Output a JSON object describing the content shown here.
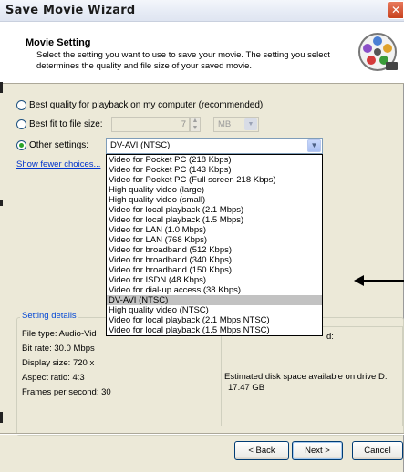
{
  "window": {
    "title": "Save Movie Wizard",
    "close_glyph": "✕"
  },
  "header": {
    "title": "Movie Setting",
    "description": "Select the setting you want to use to save your movie. The setting you select determines the quality and file size of your saved movie.",
    "icon": "film-reel-icon"
  },
  "options": {
    "best_quality_label": "Best quality for playback on my computer (recommended)",
    "best_fit_label": "Best fit to file size:",
    "file_size_value": "7",
    "unit_value": "MB",
    "other_settings_label": "Other settings:",
    "other_settings_value": "DV-AVI (NTSC)",
    "selected": "other_settings"
  },
  "show_fewer_link": "Show fewer choices...",
  "dropdown_options": [
    "Video for Pocket PC (218 Kbps)",
    "Video for Pocket PC (143 Kbps)",
    "Video for Pocket PC (Full screen 218 Kbps)",
    "High quality video (large)",
    "High quality video (small)",
    "Video for local playback (2.1 Mbps)",
    "Video for local playback (1.5 Mbps)",
    "Video for LAN (1.0 Mbps)",
    "Video for LAN (768 Kbps)",
    "Video for broadband (512 Kbps)",
    "Video for broadband (340 Kbps)",
    "Video for broadband (150 Kbps)",
    "Video for ISDN (48 Kbps)",
    "Video for dial-up access (38 Kbps)",
    "DV-AVI (NTSC)",
    "High quality video (NTSC)",
    "Video for local playback (2.1 Mbps NTSC)",
    "Video for local playback (1.5 Mbps NTSC)"
  ],
  "dropdown_selected_index": 14,
  "details": {
    "legend": "Setting details",
    "file_type": "File type: Audio-Vid",
    "bit_rate": "Bit rate: 30.0 Mbps",
    "display_size": "Display size: 720 x",
    "aspect_ratio": "Aspect ratio: 4:3",
    "fps": "Frames per second: 30",
    "right_fragment": "d:",
    "disk_space_label": "Estimated disk space available on drive D:",
    "disk_space_value": "17.47 GB"
  },
  "buttons": {
    "back": "< Back",
    "next": "Next >",
    "cancel": "Cancel"
  },
  "colors": {
    "face": "#ece9d8",
    "link": "#0033cc",
    "legend": "#0046d5",
    "selection": "#c2c2c2"
  }
}
